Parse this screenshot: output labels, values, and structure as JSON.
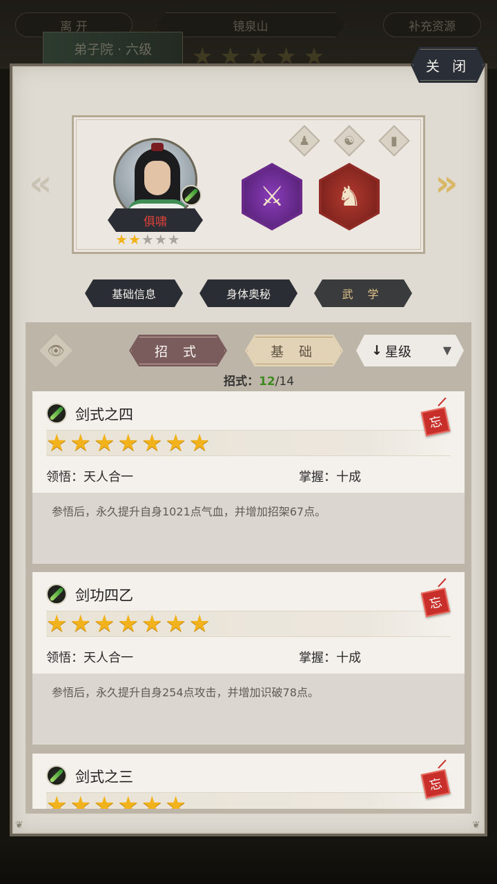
{
  "background": {
    "left_button": "离 开",
    "location": "镜泉山",
    "right_button": "补充资源",
    "banner": "弟子院 · 六级"
  },
  "close_label": "关 闭",
  "hero": {
    "name": "俱啸",
    "stars_filled": 2,
    "stars_total": 5
  },
  "section_tabs": [
    {
      "label": "基础信息",
      "active": false
    },
    {
      "label": "身体奥秘",
      "active": false
    },
    {
      "label": "武 学",
      "active": true
    }
  ],
  "filters": {
    "moves_label": "招 式",
    "basic_label": "基 础",
    "sort_label": "星级"
  },
  "moves_count": {
    "label": "招式：",
    "current": "12",
    "total": "/14"
  },
  "skills": [
    {
      "name": "剑式之四",
      "stars": 7,
      "insight": "领悟：天人合一",
      "mastery": "掌握：十成",
      "description": "参悟后，永久提升自身1021点气血，并增加招架67点。",
      "tag": "忘"
    },
    {
      "name": "剑功四乙",
      "stars": 7,
      "insight": "领悟：天人合一",
      "mastery": "掌握：十成",
      "description": "参悟后，永久提升自身254点攻击，并增加识破78点。",
      "tag": "忘"
    },
    {
      "name": "剑式之三",
      "stars": 6,
      "insight": "",
      "mastery": "",
      "description": "",
      "tag": "忘"
    }
  ],
  "colors": {
    "panel": "#dfdbd3",
    "star": "#f2b21b",
    "count_current": "#3f8a23",
    "name_red": "#e2423a"
  }
}
